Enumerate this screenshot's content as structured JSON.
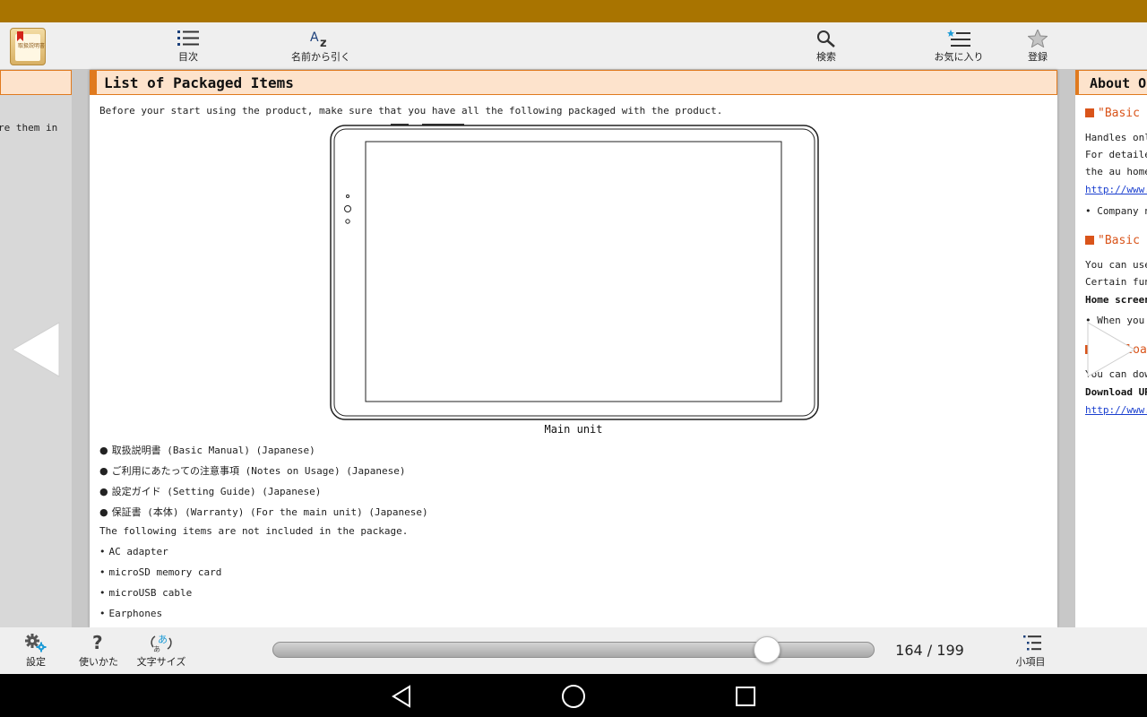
{
  "toolbar": {
    "toc_label": "目次",
    "index_label": "名前から引く",
    "search_label": "検索",
    "favorites_label": "お気に入り",
    "register_label": "登録"
  },
  "app_icon_text": "取扱説明書",
  "left_page": {
    "fragment": "re them in"
  },
  "main": {
    "title": "List of Packaged Items",
    "intro": "Before your start using the product, make sure that you have all the following packaged with the product.",
    "figure_caption": "Main unit",
    "packaged_items": [
      "取扱説明書 (Basic Manual) (Japanese)",
      "ご利用にあたっての注意事項 (Notes on Usage) (Japanese)",
      "設定ガイド (Setting Guide) (Japanese)",
      "保証書 (本体) (Warranty) (For the main unit) (Japanese)"
    ],
    "not_included_text": "The following items are not included in the package.",
    "not_included_items": [
      "AC adapter",
      "microSD memory card",
      "microUSB cable",
      "Earphones"
    ]
  },
  "right_page": {
    "title": "About Op",
    "heading1": "\"Basic M",
    "text1a": "Handles only",
    "text1b": "For detailed",
    "text1c": "the au homep",
    "link1": "http://www.a",
    "bullet1": "Company na",
    "heading2": "\"Basic M",
    "text2a": "You can use",
    "text2b": "Certain func",
    "bold2": "Home screen-",
    "bullet2": "When you a",
    "heading3": "Downloa",
    "text3a": "You can down",
    "bold3": "Download URL",
    "link3": "http://www.a"
  },
  "bottombar": {
    "settings_label": "設定",
    "howto_label": "使いかた",
    "fontsize_label": "文字サイズ",
    "subitems_label": "小項目",
    "page_counter": "164 / 199",
    "current_page": 164,
    "total_pages": 199
  },
  "icons": {
    "toc": "list-icon",
    "index": "az-icon",
    "search": "magnifier-icon",
    "favorites": "star-list-icon",
    "register": "star-icon",
    "settings": "gear-icon",
    "howto": "question-icon",
    "fontsize": "text-size-icon",
    "subitems": "sublist-icon"
  },
  "colors": {
    "status_bar": "#a97400",
    "accent_orange": "#e07a1e",
    "header_fill": "#fde3cc",
    "link_blue": "#1a3fcf"
  }
}
